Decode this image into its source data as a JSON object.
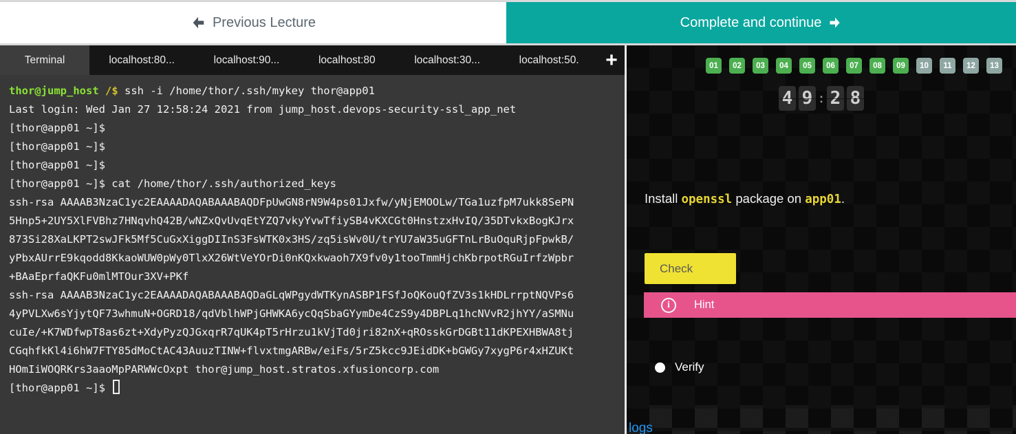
{
  "top_bar": {
    "previous_label": "Previous Lecture",
    "continue_label": "Complete and continue"
  },
  "tabs": {
    "items": [
      {
        "label": "Terminal",
        "active": true
      },
      {
        "label": "localhost:80...",
        "active": false
      },
      {
        "label": "localhost:90...",
        "active": false
      },
      {
        "label": "localhost:80",
        "active": false
      },
      {
        "label": "localhost:30...",
        "active": false
      },
      {
        "label": "localhost:50.",
        "active": false
      }
    ],
    "add_label": "+"
  },
  "terminal": {
    "lines": [
      {
        "spans": [
          [
            "thor@jump_host",
            "green"
          ],
          [
            " /$",
            "yellow"
          ],
          [
            " ssh -i /home/thor/.ssh/mykey thor@app01",
            "fg"
          ]
        ]
      },
      {
        "spans": [
          [
            "Last login: Wed Jan 27 12:58:24 2021 from jump_host.devops-security-ssl_app_net",
            "fg"
          ]
        ]
      },
      {
        "spans": [
          [
            "[thor@app01 ~]$",
            "fg"
          ]
        ]
      },
      {
        "spans": [
          [
            "[thor@app01 ~]$",
            "fg"
          ]
        ]
      },
      {
        "spans": [
          [
            "[thor@app01 ~]$",
            "fg"
          ]
        ]
      },
      {
        "spans": [
          [
            "[thor@app01 ~]$ cat /home/thor/.ssh/authorized_keys",
            "fg"
          ]
        ]
      },
      {
        "spans": [
          [
            "ssh-rsa AAAAB3NzaC1yc2EAAAADAQABAAABAQDFpUwGN8rN9W4ps01Jxfw/yNjEMOOLw/TGa1uzfpM7ukk8SePN",
            "fg"
          ]
        ]
      },
      {
        "spans": [
          [
            "5Hnp5+2UY5XlFVBhz7HNqvhQ42B/wNZxQvUvqEtYZQ7vkyYvwTfiySB4vKXCGt0HnstzxHvIQ/35DTvkxBogKJrx",
            "fg"
          ]
        ]
      },
      {
        "spans": [
          [
            "873Si28XaLKPT2swJFk5Mf5CuGxXiggDIInS3FsWTK0x3HS/zq5isWv0U/trYU7aW35uGFTnLrBuOquRjpFpwkB/",
            "fg"
          ]
        ]
      },
      {
        "spans": [
          [
            "yPbxAUrrE9kqodd8KkaoWUW0pWy0TlxX26WtVeYOrDi0nKQxkwaoh7X9fv0y1tooTmmHjchKbrpotRGuIrfzWpbr",
            "fg"
          ]
        ]
      },
      {
        "spans": [
          [
            "+BAaEprfaQKFu0mlMTOur3XV+PKf",
            "fg"
          ]
        ]
      },
      {
        "spans": [
          [
            "ssh-rsa AAAAB3NzaC1yc2EAAAADAQABAAABAQDaGLqWPgydWTKynASBP1FSfJoQKouQfZV3s1kHDLrrptNQVPs6",
            "fg"
          ]
        ]
      },
      {
        "spans": [
          [
            "4yPVLXw6sYjytQF73whmuN+OGRD18/qdVblhWPjGHWKA6ycQqSbaGYymDe4CzS9y4DBPLq1hcNVvR2jhYY/aSMNu",
            "fg"
          ]
        ]
      },
      {
        "spans": [
          [
            "cuIe/+K7WDfwpT8as6zt+XdyPyzQJGxqrR7qUK4pT5rHrzu1kVjTd0jri82nX+qROsskGrDGBt11dKPEXHBWA8tj",
            "fg"
          ]
        ]
      },
      {
        "spans": [
          [
            "CGqhfkKl4i6hW7FTY85dMoCtAC43AuuzTINW+flvxtmgARBw/eiFs/5rZ5kcc9JEidDK+bGWGy7xygP6r4xHZUKt",
            "fg"
          ]
        ]
      },
      {
        "spans": [
          [
            "HOmIiWOQRKrs3aaoMpPARWWcOxpt thor@jump_host.stratos.xfusioncorp.com",
            "fg"
          ]
        ]
      },
      {
        "spans": [
          [
            "[thor@app01 ~]$ ",
            "fg"
          ]
        ],
        "cursor": true
      }
    ]
  },
  "right_panel": {
    "steps": [
      {
        "label": "01",
        "state": "done"
      },
      {
        "label": "02",
        "state": "done"
      },
      {
        "label": "03",
        "state": "done"
      },
      {
        "label": "04",
        "state": "done"
      },
      {
        "label": "05",
        "state": "done"
      },
      {
        "label": "06",
        "state": "done"
      },
      {
        "label": "07",
        "state": "done"
      },
      {
        "label": "08",
        "state": "done"
      },
      {
        "label": "09",
        "state": "done"
      },
      {
        "label": "10",
        "state": "pending"
      },
      {
        "label": "11",
        "state": "pending"
      },
      {
        "label": "12",
        "state": "pending"
      },
      {
        "label": "13",
        "state": "pending"
      }
    ],
    "timer": {
      "digits": [
        "4",
        "9",
        "2",
        "8"
      ],
      "separator": ":"
    },
    "task": {
      "part1": "Install ",
      "code1": "openssl",
      "part2": " package on ",
      "code2": "app01",
      "part3": "."
    },
    "check_label": "Check",
    "hint_icon_glyph": "i",
    "hint_label": "Hint",
    "verify_label": "Verify",
    "logs_label": "logs"
  },
  "colors": {
    "teal_accent": "#0aa79e",
    "terminal_bg": "#383838",
    "prompt_green": "#8ae234",
    "prompt_yellow": "#d4c12a",
    "check_yellow": "#f0e232",
    "hint_pink": "#e7548c",
    "step_done_green": "#4caf50",
    "step_pending_gray": "#8fa7a3",
    "logs_blue": "#2196f3"
  }
}
